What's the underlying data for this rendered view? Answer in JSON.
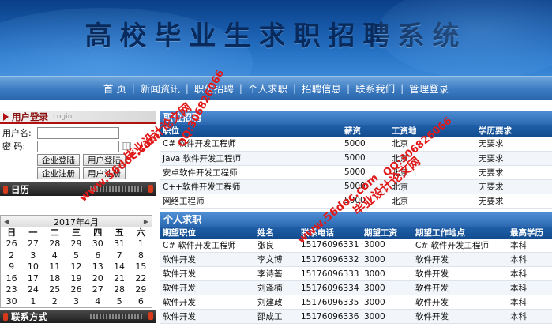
{
  "header": {
    "title": "高校毕业生求职招聘系统"
  },
  "nav": {
    "items": [
      "首 页",
      "新闻资讯",
      "职位招聘",
      "个人求职",
      "招聘信息",
      "联系我们",
      "管理登录"
    ]
  },
  "login": {
    "title": "用户登录",
    "subtitle": "Login",
    "username_label": "用户名:",
    "password_label": "密 码:",
    "buttons": [
      "企业登陆",
      "用户登陆",
      "企业注册",
      "用户注册"
    ]
  },
  "calendar_box": {
    "title": "日历",
    "month": "2017年4月",
    "weekdays": [
      "日",
      "一",
      "二",
      "三",
      "四",
      "五",
      "六"
    ],
    "days": [
      "26",
      "27",
      "28",
      "29",
      "30",
      "31",
      "1",
      "2",
      "3",
      "4",
      "5",
      "6",
      "7",
      "8",
      "9",
      "10",
      "11",
      "12",
      "13",
      "14",
      "15",
      "16",
      "17",
      "18",
      "19",
      "20",
      "21",
      "22",
      "23",
      "24",
      "25",
      "26",
      "27",
      "28",
      "29",
      "30",
      "1",
      "2",
      "3",
      "4",
      "5",
      "6"
    ]
  },
  "contact_box": {
    "title": "联系方式"
  },
  "jobs": {
    "title": "职位招聘",
    "headers": [
      "职位",
      "薪资",
      "工资地",
      "学历要求"
    ],
    "rows": [
      [
        "C# 软件开发工程师",
        "5000",
        "北京",
        "无要求"
      ],
      [
        "Java 软件开发工程师",
        "5000",
        "北京",
        "无要求"
      ],
      [
        "安卓软件开发工程师",
        "5000",
        "北京",
        "无要求"
      ],
      [
        "C++软件开发工程师",
        "5000",
        "北京",
        "无要求"
      ],
      [
        "网络工程师",
        "5000",
        "北京",
        "无要求"
      ]
    ]
  },
  "seekers": {
    "title": "个人求职",
    "headers": [
      "期望职位",
      "姓名",
      "联系电话",
      "期望工资",
      "期望工作地点",
      "最高学历"
    ],
    "rows": [
      [
        "C# 软件开发工程师",
        "张良",
        "15176096331",
        "3000",
        "C# 软件开发工程师",
        "本科"
      ],
      [
        "软件开发",
        "李文博",
        "15176096332",
        "3000",
        "软件开发",
        "本科"
      ],
      [
        "软件开发",
        "李诗荟",
        "15176096333",
        "3000",
        "软件开发",
        "本科"
      ],
      [
        "软件开发",
        "刘泽楠",
        "15176096334",
        "3000",
        "软件开发",
        "本科"
      ],
      [
        "软件开发",
        "刘建政",
        "15176096335",
        "3000",
        "软件开发",
        "本科"
      ],
      [
        "软件开发",
        "邵成工",
        "15176096336",
        "3000",
        "软件开发",
        "本科"
      ]
    ]
  },
  "watermarks": [
    "毕业设计论文网",
    "www.56doc.com",
    "QQ:306826066"
  ],
  "colors": {
    "banner": "#1a5fb0",
    "nav": "#3d7cc2",
    "table_header": "#1f5fa8",
    "watermark": "#e01919"
  }
}
